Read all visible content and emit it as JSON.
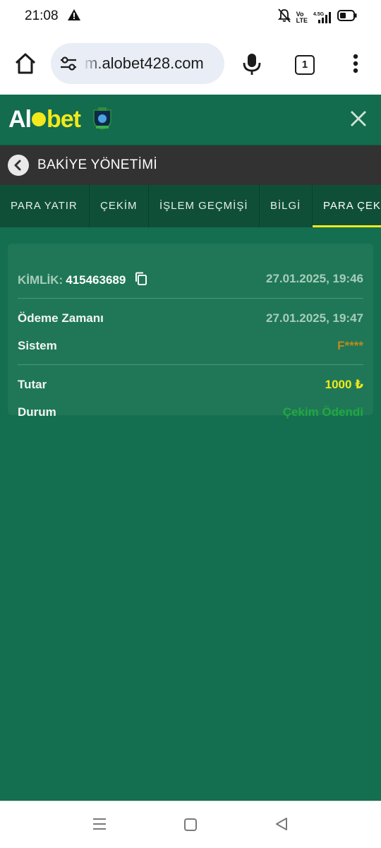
{
  "status_bar": {
    "time": "21:08",
    "volte": "Vo\nLTE",
    "network": "4.5G"
  },
  "browser": {
    "url": "m.alobet428.com",
    "tab_count": "1"
  },
  "app": {
    "logo_left": "Al",
    "logo_right": "bet"
  },
  "page": {
    "title": "BAKİYE YÖNETİMİ"
  },
  "tabs": [
    {
      "label": "PARA YATIR"
    },
    {
      "label": "ÇEKİM"
    },
    {
      "label": "İŞLEM GEÇMİŞİ"
    },
    {
      "label": "BİLGİ"
    },
    {
      "label": "PARA ÇEK"
    }
  ],
  "transaction": {
    "id_label": "KİMLİK:",
    "id_value": "415463689",
    "created": "27.01.2025, 19:46",
    "payment_time_label": "Ödeme Zamanı",
    "payment_time_value": "27.01.2025, 19:47",
    "system_label": "Sistem",
    "system_value": "F****",
    "amount_label": "Tutar",
    "amount_value": "1000 ₺",
    "status_label": "Durum",
    "status_value": "Çekim Ödendi"
  },
  "colors": {
    "brand_green": "#146e50",
    "brand_yellow": "#f3e81b",
    "system_value": "#c08a1a",
    "status_value": "#21a83f"
  }
}
